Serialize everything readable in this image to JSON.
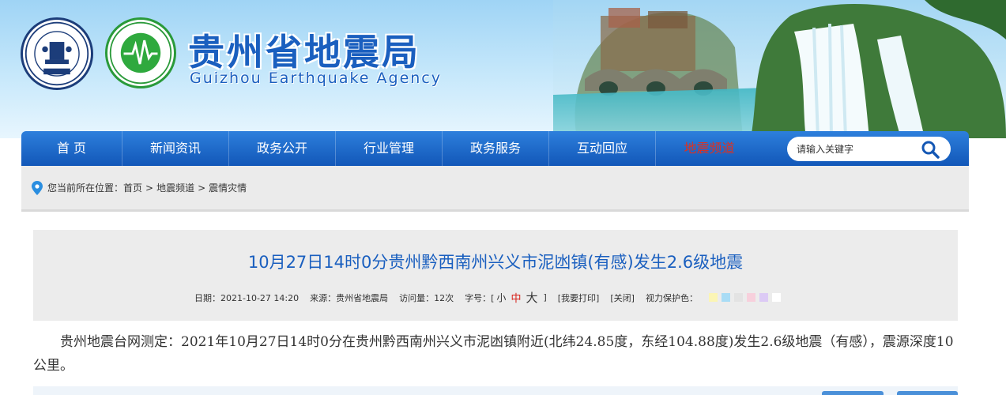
{
  "header": {
    "title": "贵州省地震局",
    "subtitle": "Guizhou Earthquake Agency"
  },
  "nav": {
    "items": [
      "首 页",
      "新闻资讯",
      "政务公开",
      "行业管理",
      "政务服务",
      "互动回应",
      "地震频道"
    ],
    "active_index": 6,
    "search_placeholder": "请输入关键字"
  },
  "breadcrumb": {
    "prefix": "您当前所在位置：",
    "items": [
      "首页",
      "地震频道",
      "震情灾情"
    ],
    "separator": ">"
  },
  "article": {
    "title": "10月27日14时0分贵州黔西南州兴义市泥凼镇(有感)发生2.6级地震",
    "date": "日期：2021-10-27 14:20",
    "source": "来源：贵州省地震局",
    "views": "访问量：12次",
    "font_size_label": "字号：[",
    "font_small": "小",
    "font_mid": "中",
    "font_large": "大",
    "font_close": "]",
    "print": "[我要打印]",
    "close": "[关闭]",
    "eye_care": "视力保护色：",
    "body": "贵州地震台网测定：2021年10月27日14时0分在贵州黔西南州兴义市泥凼镇附近(北纬24.85度，东经104.88度)发生2.6级地震（有感），震源深度10公里。"
  },
  "colors": {
    "nav_top": "#2d7fdc",
    "nav_bottom": "#1257b8",
    "title_blue": "#1a5fbf",
    "active_red": "#e0301e",
    "swatches": [
      "#fbf5b5",
      "#a9dcf5",
      "#e3e3e3",
      "#f7d0dc",
      "#dccaf5",
      "#ffffff"
    ]
  },
  "icons": {
    "logo_left": "china-earthquake-administration-emblem",
    "logo_right": "guizhou-earthquake-agency-seal",
    "search": "magnifier",
    "location": "map-pin"
  }
}
